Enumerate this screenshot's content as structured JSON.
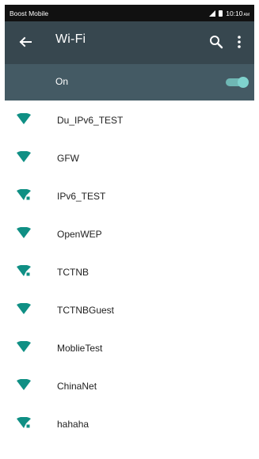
{
  "status_bar": {
    "carrier": "Boost Mobile",
    "time": "10:10",
    "time_suffix": "AM"
  },
  "app_bar": {
    "title": "Wi-Fi",
    "back_icon": "arrow-left-icon",
    "search_icon": "search-icon",
    "more_icon": "more-vertical-icon"
  },
  "switch": {
    "label": "On",
    "state": "on",
    "color": "#7fd2cd"
  },
  "networks": [
    {
      "ssid": "Du_IPv6_TEST",
      "secured": false
    },
    {
      "ssid": "GFW",
      "secured": false
    },
    {
      "ssid": "IPv6_TEST",
      "secured": true
    },
    {
      "ssid": "OpenWEP",
      "secured": false
    },
    {
      "ssid": "TCTNB",
      "secured": true
    },
    {
      "ssid": "TCTNBGuest",
      "secured": false
    },
    {
      "ssid": "MoblieTest",
      "secured": false
    },
    {
      "ssid": "ChinaNet",
      "secured": false
    },
    {
      "ssid": "hahaha",
      "secured": true
    }
  ],
  "colors": {
    "app_bar": "#37474f",
    "switch_bar": "#445a64",
    "accent": "#0f8f84"
  }
}
